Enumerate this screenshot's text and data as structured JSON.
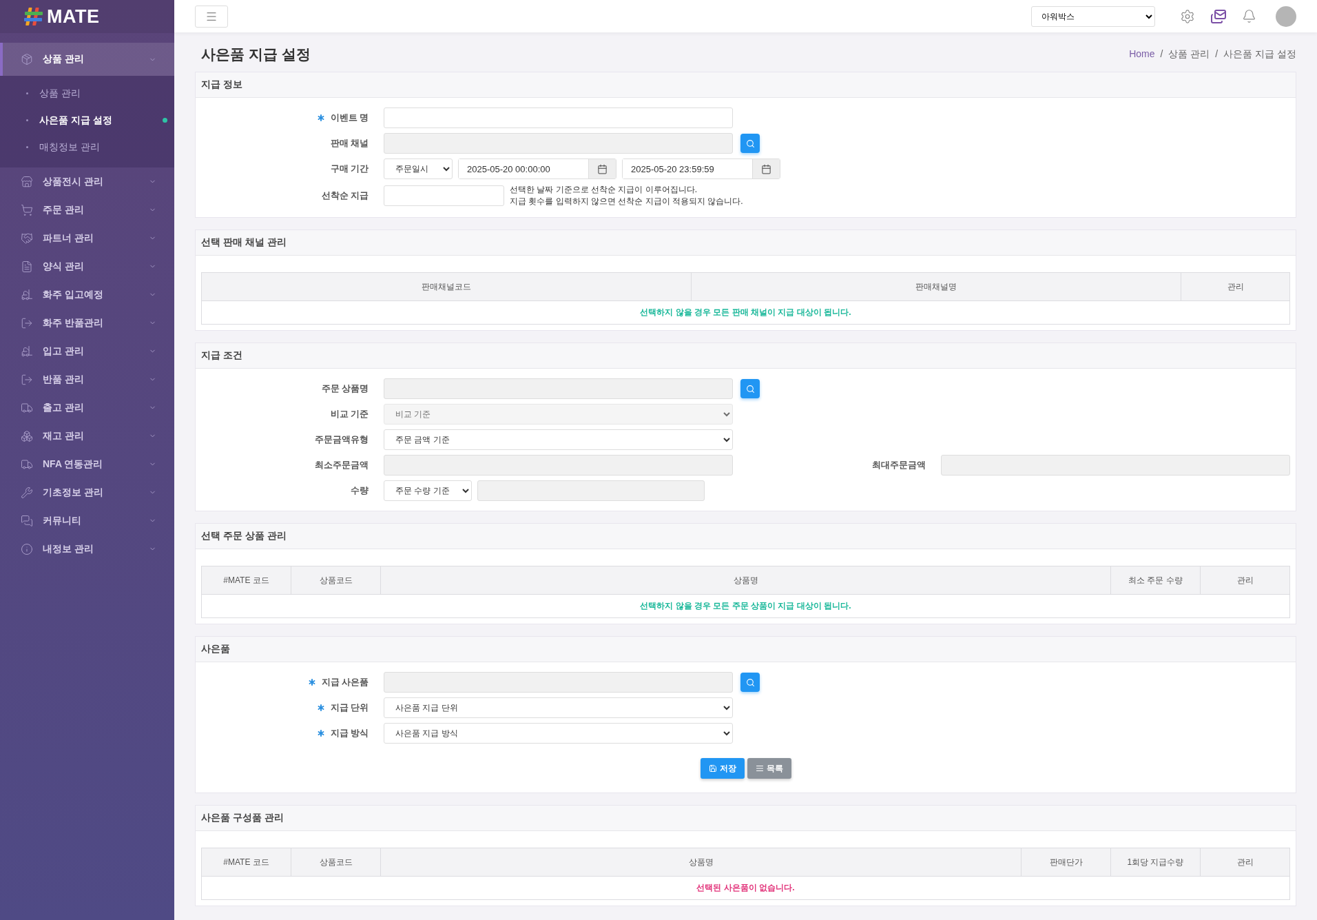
{
  "brand": {
    "name": "MATE"
  },
  "sidebar": {
    "items": [
      {
        "label": "상품 관리",
        "selected": true,
        "children": [
          {
            "label": "상품 관리",
            "selected": false
          },
          {
            "label": "사은품 지급 설정",
            "selected": true
          },
          {
            "label": "매칭정보 관리",
            "selected": false
          }
        ]
      },
      {
        "label": "상품전시 관리",
        "selected": false
      },
      {
        "label": "주문 관리",
        "selected": false
      },
      {
        "label": "파트너 관리",
        "selected": false
      },
      {
        "label": "양식 관리",
        "selected": false
      },
      {
        "label": "화주 입고예정",
        "selected": false
      },
      {
        "label": "화주 반품관리",
        "selected": false
      },
      {
        "label": "입고 관리",
        "selected": false
      },
      {
        "label": "반품 관리",
        "selected": false
      },
      {
        "label": "출고 관리",
        "selected": false
      },
      {
        "label": "재고 관리",
        "selected": false
      },
      {
        "label": "NFA 연동관리",
        "selected": false
      },
      {
        "label": "기초정보 관리",
        "selected": false
      },
      {
        "label": "커뮤니티",
        "selected": false
      },
      {
        "label": "내정보 관리",
        "selected": false
      }
    ]
  },
  "topbar": {
    "company_select": {
      "value": "아워박스"
    }
  },
  "page_title": "사은품 지급 설정",
  "breadcrumb": [
    "Home",
    "상품 관리",
    "사은품 지급 설정"
  ],
  "breadcrumb_separator": "/",
  "sections": [
    {
      "kind": "form",
      "title": "지급 정보",
      "rows": [
        {
          "label": "이벤트 명",
          "required": true,
          "controls": [
            {
              "kind": "input",
              "disabled": false
            }
          ]
        },
        {
          "label": "판매 채널",
          "required": false,
          "controls": [
            {
              "kind": "input",
              "disabled": true
            },
            {
              "kind": "search"
            }
          ]
        },
        {
          "label": "구매 기간",
          "required": false,
          "controls": [
            {
              "kind": "select",
              "value": "주문일시",
              "disabled": false
            },
            {
              "kind": "date",
              "value": "2025-05-20 00:00:00"
            },
            {
              "kind": "date",
              "value": "2025-05-20 23:59:59"
            }
          ]
        },
        {
          "label": "선착순 지급",
          "required": false,
          "controls": [
            {
              "kind": "input",
              "disabled": false
            },
            {
              "kind": "hint",
              "lines": [
                "선택한 날짜 기준으로 선착순 지급이 이루어집니다.",
                "지급 횟수를 입력하지 않으면 선착순 지급이 적용되지 않습니다."
              ]
            }
          ]
        }
      ]
    },
    {
      "kind": "table",
      "title": "선택 판매 채널 관리",
      "columns": [
        "판매채널코드",
        "판매채널명",
        "관리"
      ],
      "message": "선택하지 않을 경우 모든 판매 채널이 지급 대상이 됩니다.",
      "color": "#1bb89a"
    },
    {
      "kind": "form",
      "title": "지급 조건",
      "rows": [
        {
          "label": "주문 상품명",
          "required": false,
          "controls": [
            {
              "kind": "input",
              "disabled": true
            },
            {
              "kind": "search"
            }
          ]
        },
        {
          "label": "비교 기준",
          "required": false,
          "controls": [
            {
              "kind": "select",
              "value": "비교 기준",
              "disabled": true
            }
          ]
        },
        {
          "label": "주문금액유형",
          "required": false,
          "controls": [
            {
              "kind": "select",
              "value": "주문 금액 기준",
              "disabled": false
            }
          ]
        },
        {
          "label": "최소주문금액",
          "required": false,
          "controls": [
            {
              "kind": "input",
              "disabled": true
            }
          ],
          "side": {
            "label": "최대주문금액",
            "controls": [
              {
                "kind": "input",
                "disabled": true
              }
            ]
          }
        },
        {
          "label": "수량",
          "required": false,
          "controls": [
            {
              "kind": "select",
              "value": "주문 수량 기준",
              "disabled": false
            },
            {
              "kind": "input",
              "disabled": true
            }
          ]
        }
      ]
    },
    {
      "kind": "table",
      "title": "선택 주문 상품 관리",
      "columns": [
        "#MATE 코드",
        "상품코드",
        "상품명",
        "최소 주문 수량",
        "관리"
      ],
      "message": "선택하지 않을 경우 모든 주문 상품이 지급 대상이 됩니다.",
      "color": "#1bb89a"
    },
    {
      "kind": "form",
      "title": "사은품",
      "rows": [
        {
          "label": "지급 사은품",
          "required": true,
          "controls": [
            {
              "kind": "input",
              "disabled": true
            },
            {
              "kind": "search"
            }
          ]
        },
        {
          "label": "지급 단위",
          "required": true,
          "controls": [
            {
              "kind": "select",
              "value": "사은품 지급 단위",
              "disabled": false
            }
          ]
        },
        {
          "label": "지급 방식",
          "required": true,
          "controls": [
            {
              "kind": "select",
              "value": "사은품 지급 방식",
              "disabled": false
            }
          ]
        }
      ],
      "actions": [
        {
          "label": "저장",
          "kind": "primary"
        },
        {
          "label": "목록",
          "kind": "secondary"
        }
      ]
    },
    {
      "kind": "table",
      "title": "사은품 구성품 관리",
      "columns": [
        "#MATE 코드",
        "상품코드",
        "상품명",
        "판매단가",
        "1회당 지급수량",
        "관리"
      ],
      "message": "선택된 사은품이 없습니다.",
      "color": "#e2337a"
    }
  ]
}
